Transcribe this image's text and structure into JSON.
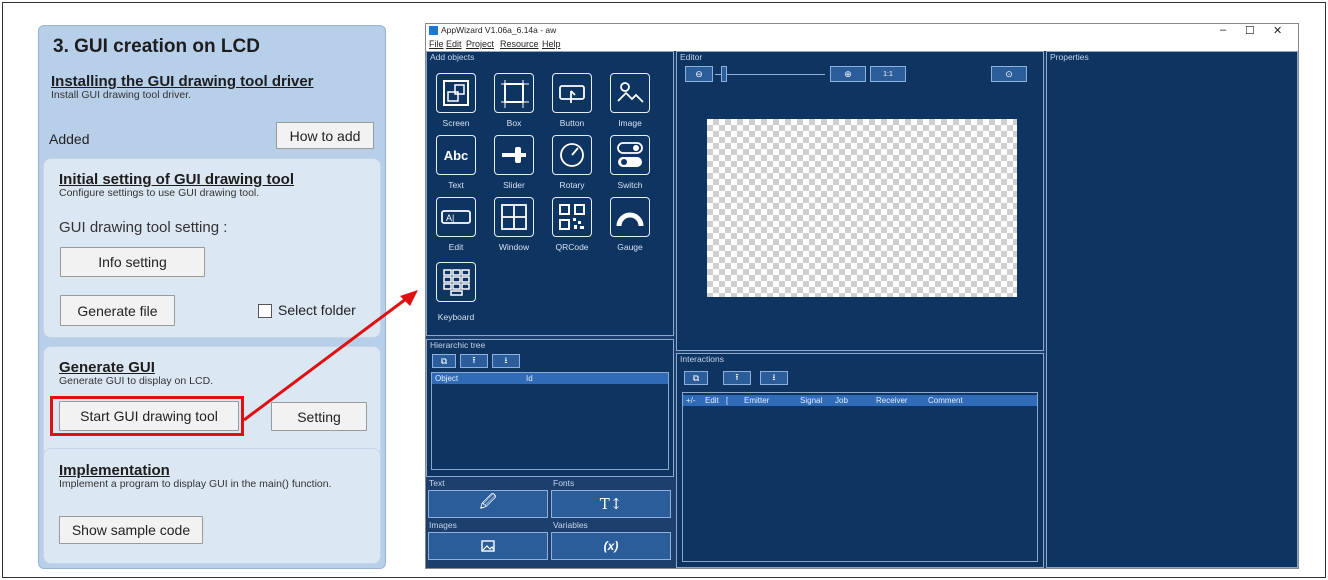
{
  "left_panel": {
    "title": "3. GUI creation on LCD",
    "install": {
      "heading": "Installing the GUI drawing tool driver",
      "desc": "Install GUI drawing tool driver.",
      "status": "Added",
      "how_to_add_label": "How to add"
    },
    "initial": {
      "heading": "Initial setting of GUI drawing tool",
      "desc": "Configure settings to use GUI drawing tool.",
      "setting_label": "GUI drawing tool setting :",
      "info_setting_label": "Info setting",
      "generate_file_label": "Generate file",
      "select_folder_label": "Select folder",
      "select_folder_checked": false
    },
    "generate": {
      "heading": "Generate GUI",
      "desc": "Generate GUI to display on LCD.",
      "start_label": "Start GUI drawing tool",
      "setting_label": "Setting"
    },
    "implementation": {
      "heading": "Implementation",
      "desc": "Implement a program to display GUI in the main() function.",
      "show_sample_label": "Show sample code"
    }
  },
  "app": {
    "title": "AppWizard V1.06a_6.14a - aw",
    "menu": [
      "File",
      "Edit",
      "Project",
      "Resource",
      "Help"
    ],
    "window_controls": [
      "–",
      "☐",
      "✕"
    ],
    "add_objects": {
      "header": "Add objects",
      "items": [
        "Screen",
        "Box",
        "Button",
        "Image",
        "Text",
        "Slider",
        "Rotary",
        "Switch",
        "Edit",
        "Window",
        "QRCode",
        "Gauge",
        "Keyboard"
      ]
    },
    "editor": {
      "header": "Editor",
      "zoom_label": "1:1"
    },
    "properties": {
      "header": "Properties"
    },
    "hierarchic": {
      "header": "Hierarchic tree",
      "columns": [
        "Object",
        "Id"
      ]
    },
    "interactions": {
      "header": "Interactions",
      "columns": [
        "+/-",
        "Edit",
        "[",
        "Emitter",
        "Signal",
        "Job",
        "Receiver",
        "Comment"
      ]
    },
    "resources": {
      "text_label": "Text",
      "fonts_label": "Fonts",
      "images_label": "Images",
      "variables_label": "Variables",
      "fonts_icon_text": "T↕",
      "variables_icon_text": "(x)"
    }
  },
  "colors": {
    "panel_bg": "#b8cfea",
    "card_bg": "#dce7f4",
    "highlight": "#e01010",
    "app_bg": "#0e3462"
  }
}
